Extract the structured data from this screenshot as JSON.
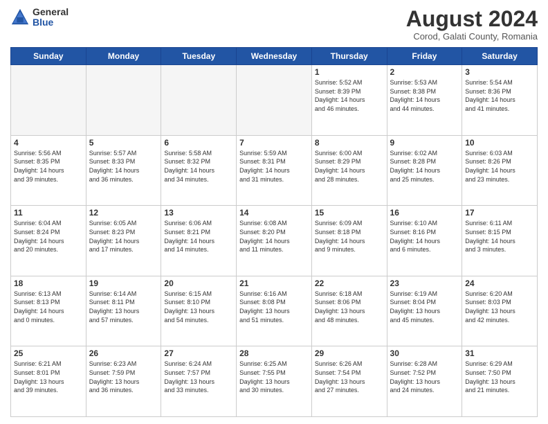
{
  "logo": {
    "general": "General",
    "blue": "Blue"
  },
  "header": {
    "title": "August 2024",
    "subtitle": "Corod, Galati County, Romania"
  },
  "weekdays": [
    "Sunday",
    "Monday",
    "Tuesday",
    "Wednesday",
    "Thursday",
    "Friday",
    "Saturday"
  ],
  "weeks": [
    [
      {
        "day": "",
        "info": ""
      },
      {
        "day": "",
        "info": ""
      },
      {
        "day": "",
        "info": ""
      },
      {
        "day": "",
        "info": ""
      },
      {
        "day": "1",
        "info": "Sunrise: 5:52 AM\nSunset: 8:39 PM\nDaylight: 14 hours\nand 46 minutes."
      },
      {
        "day": "2",
        "info": "Sunrise: 5:53 AM\nSunset: 8:38 PM\nDaylight: 14 hours\nand 44 minutes."
      },
      {
        "day": "3",
        "info": "Sunrise: 5:54 AM\nSunset: 8:36 PM\nDaylight: 14 hours\nand 41 minutes."
      }
    ],
    [
      {
        "day": "4",
        "info": "Sunrise: 5:56 AM\nSunset: 8:35 PM\nDaylight: 14 hours\nand 39 minutes."
      },
      {
        "day": "5",
        "info": "Sunrise: 5:57 AM\nSunset: 8:33 PM\nDaylight: 14 hours\nand 36 minutes."
      },
      {
        "day": "6",
        "info": "Sunrise: 5:58 AM\nSunset: 8:32 PM\nDaylight: 14 hours\nand 34 minutes."
      },
      {
        "day": "7",
        "info": "Sunrise: 5:59 AM\nSunset: 8:31 PM\nDaylight: 14 hours\nand 31 minutes."
      },
      {
        "day": "8",
        "info": "Sunrise: 6:00 AM\nSunset: 8:29 PM\nDaylight: 14 hours\nand 28 minutes."
      },
      {
        "day": "9",
        "info": "Sunrise: 6:02 AM\nSunset: 8:28 PM\nDaylight: 14 hours\nand 25 minutes."
      },
      {
        "day": "10",
        "info": "Sunrise: 6:03 AM\nSunset: 8:26 PM\nDaylight: 14 hours\nand 23 minutes."
      }
    ],
    [
      {
        "day": "11",
        "info": "Sunrise: 6:04 AM\nSunset: 8:24 PM\nDaylight: 14 hours\nand 20 minutes."
      },
      {
        "day": "12",
        "info": "Sunrise: 6:05 AM\nSunset: 8:23 PM\nDaylight: 14 hours\nand 17 minutes."
      },
      {
        "day": "13",
        "info": "Sunrise: 6:06 AM\nSunset: 8:21 PM\nDaylight: 14 hours\nand 14 minutes."
      },
      {
        "day": "14",
        "info": "Sunrise: 6:08 AM\nSunset: 8:20 PM\nDaylight: 14 hours\nand 11 minutes."
      },
      {
        "day": "15",
        "info": "Sunrise: 6:09 AM\nSunset: 8:18 PM\nDaylight: 14 hours\nand 9 minutes."
      },
      {
        "day": "16",
        "info": "Sunrise: 6:10 AM\nSunset: 8:16 PM\nDaylight: 14 hours\nand 6 minutes."
      },
      {
        "day": "17",
        "info": "Sunrise: 6:11 AM\nSunset: 8:15 PM\nDaylight: 14 hours\nand 3 minutes."
      }
    ],
    [
      {
        "day": "18",
        "info": "Sunrise: 6:13 AM\nSunset: 8:13 PM\nDaylight: 14 hours\nand 0 minutes."
      },
      {
        "day": "19",
        "info": "Sunrise: 6:14 AM\nSunset: 8:11 PM\nDaylight: 13 hours\nand 57 minutes."
      },
      {
        "day": "20",
        "info": "Sunrise: 6:15 AM\nSunset: 8:10 PM\nDaylight: 13 hours\nand 54 minutes."
      },
      {
        "day": "21",
        "info": "Sunrise: 6:16 AM\nSunset: 8:08 PM\nDaylight: 13 hours\nand 51 minutes."
      },
      {
        "day": "22",
        "info": "Sunrise: 6:18 AM\nSunset: 8:06 PM\nDaylight: 13 hours\nand 48 minutes."
      },
      {
        "day": "23",
        "info": "Sunrise: 6:19 AM\nSunset: 8:04 PM\nDaylight: 13 hours\nand 45 minutes."
      },
      {
        "day": "24",
        "info": "Sunrise: 6:20 AM\nSunset: 8:03 PM\nDaylight: 13 hours\nand 42 minutes."
      }
    ],
    [
      {
        "day": "25",
        "info": "Sunrise: 6:21 AM\nSunset: 8:01 PM\nDaylight: 13 hours\nand 39 minutes."
      },
      {
        "day": "26",
        "info": "Sunrise: 6:23 AM\nSunset: 7:59 PM\nDaylight: 13 hours\nand 36 minutes."
      },
      {
        "day": "27",
        "info": "Sunrise: 6:24 AM\nSunset: 7:57 PM\nDaylight: 13 hours\nand 33 minutes."
      },
      {
        "day": "28",
        "info": "Sunrise: 6:25 AM\nSunset: 7:55 PM\nDaylight: 13 hours\nand 30 minutes."
      },
      {
        "day": "29",
        "info": "Sunrise: 6:26 AM\nSunset: 7:54 PM\nDaylight: 13 hours\nand 27 minutes."
      },
      {
        "day": "30",
        "info": "Sunrise: 6:28 AM\nSunset: 7:52 PM\nDaylight: 13 hours\nand 24 minutes."
      },
      {
        "day": "31",
        "info": "Sunrise: 6:29 AM\nSunset: 7:50 PM\nDaylight: 13 hours\nand 21 minutes."
      }
    ]
  ]
}
